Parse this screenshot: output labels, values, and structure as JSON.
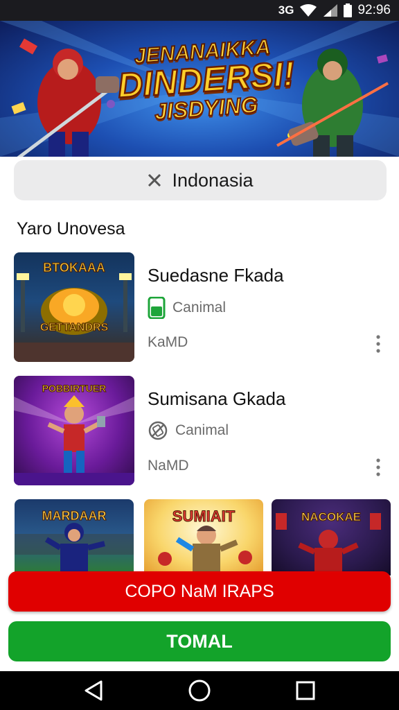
{
  "status": {
    "time": "92:96",
    "network_label": "3G"
  },
  "banner": {
    "line1": "JENANAIKKA",
    "line2": "DINDERSI!",
    "line3": "JISDYING"
  },
  "search": {
    "value": "Indonasia"
  },
  "section": {
    "title": "Yaro Unovesa"
  },
  "items": [
    {
      "title": "Suedasne Fkada",
      "sub": "Canimal",
      "meta": "KaMD",
      "thumb_label_top": "BTOKAAA",
      "thumb_label_bottom": "GETTANDRS"
    },
    {
      "title": "Sumisana Gkada",
      "sub": "Canimal",
      "meta": "NaMD",
      "thumb_label_top": "POBBIRTUER"
    }
  ],
  "grid": [
    {
      "label": "MARDAAR"
    },
    {
      "label": "SUMIAIT"
    },
    {
      "label": "NACOKAE"
    }
  ],
  "buttons": {
    "primary": "COPO NaM IRAPS",
    "secondary": "TOMAL"
  },
  "colors": {
    "primary_button": "#e00000",
    "secondary_button": "#13a32a",
    "status_bar": "#1b1b1f"
  },
  "icons": [
    "signal-icon",
    "wifi-icon",
    "battery-icon",
    "close-icon",
    "phone-icon",
    "no-phone-icon",
    "more-vert-icon",
    "back-icon",
    "home-icon",
    "recents-icon"
  ]
}
